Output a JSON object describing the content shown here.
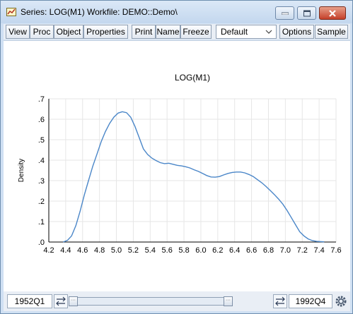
{
  "window": {
    "title": "Series: LOG(M1)   Workfile: DEMO::Demo\\"
  },
  "toolbar": {
    "buttons": [
      "View",
      "Proc",
      "Object",
      "Properties",
      "Print",
      "Name",
      "Freeze"
    ],
    "dropdown_value": "Default",
    "right_buttons": [
      "Options",
      "Sample"
    ]
  },
  "chart_data": {
    "type": "line",
    "title": "LOG(M1)",
    "xlabel": "",
    "ylabel": "Density",
    "xlim": [
      4.2,
      7.6
    ],
    "ylim": [
      0,
      0.7
    ],
    "x_ticks": [
      "4.2",
      "4.4",
      "4.6",
      "4.8",
      "5.0",
      "5.2",
      "5.4",
      "5.6",
      "5.8",
      "6.0",
      "6.2",
      "6.4",
      "6.6",
      "6.8",
      "7.0",
      "7.2",
      "7.4",
      "7.6"
    ],
    "y_ticks": [
      ".0",
      ".1",
      ".2",
      ".3",
      ".4",
      ".5",
      ".6",
      ".7"
    ],
    "grid": true,
    "color": "#4a86c8",
    "x": [
      4.37,
      4.42,
      4.47,
      4.52,
      4.57,
      4.62,
      4.67,
      4.72,
      4.77,
      4.82,
      4.87,
      4.92,
      4.97,
      5.02,
      5.07,
      5.12,
      5.17,
      5.22,
      5.27,
      5.32,
      5.37,
      5.42,
      5.47,
      5.52,
      5.57,
      5.62,
      5.67,
      5.72,
      5.77,
      5.82,
      5.87,
      5.92,
      5.97,
      6.02,
      6.07,
      6.12,
      6.17,
      6.22,
      6.27,
      6.32,
      6.37,
      6.42,
      6.47,
      6.52,
      6.57,
      6.62,
      6.67,
      6.72,
      6.77,
      6.82,
      6.87,
      6.92,
      6.97,
      7.02,
      7.07,
      7.12,
      7.17,
      7.22,
      7.27,
      7.32,
      7.37,
      7.42,
      7.46
    ],
    "y": [
      0.0,
      0.008,
      0.03,
      0.08,
      0.15,
      0.23,
      0.3,
      0.37,
      0.43,
      0.49,
      0.54,
      0.58,
      0.61,
      0.63,
      0.637,
      0.632,
      0.61,
      0.565,
      0.51,
      0.455,
      0.428,
      0.41,
      0.398,
      0.388,
      0.383,
      0.385,
      0.38,
      0.375,
      0.372,
      0.368,
      0.362,
      0.353,
      0.345,
      0.335,
      0.325,
      0.318,
      0.317,
      0.32,
      0.328,
      0.335,
      0.34,
      0.342,
      0.342,
      0.338,
      0.33,
      0.32,
      0.305,
      0.29,
      0.272,
      0.252,
      0.232,
      0.21,
      0.185,
      0.155,
      0.12,
      0.085,
      0.05,
      0.03,
      0.015,
      0.007,
      0.003,
      0.002,
      0.001
    ]
  },
  "bottombar": {
    "start_date": "1952Q1",
    "end_date": "1992Q4"
  },
  "colors": {
    "frame": "#cfe0f3",
    "close_button": "#c4402a"
  }
}
